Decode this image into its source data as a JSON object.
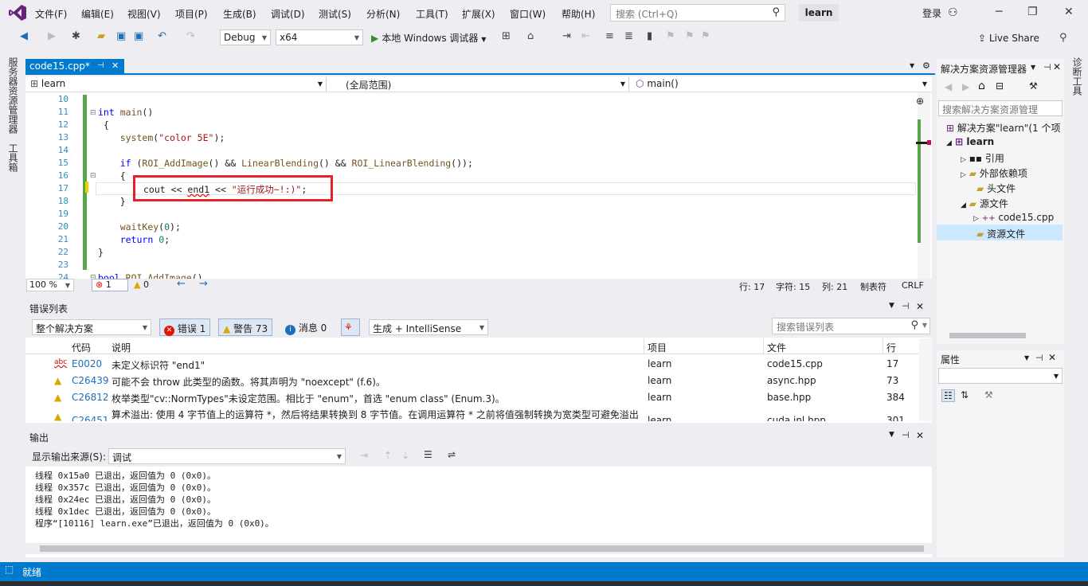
{
  "menu": {
    "items": [
      "文件(F)",
      "编辑(E)",
      "视图(V)",
      "项目(P)",
      "生成(B)",
      "调试(D)",
      "测试(S)",
      "分析(N)",
      "工具(T)",
      "扩展(X)",
      "窗口(W)",
      "帮助(H)"
    ],
    "search_placeholder": "搜索 (Ctrl+Q)",
    "project_name": "learn",
    "login": "登录"
  },
  "toolbar": {
    "config": "Debug",
    "platform": "x64",
    "run_label": "本地 Windows 调试器",
    "live_share": "Live Share"
  },
  "left_strip": {
    "server_explorer": "服务器资源管理器",
    "toolbox": "工具箱"
  },
  "right_strip": {
    "diagnostics": "诊断工具"
  },
  "editor": {
    "tab_label": "code15.cpp*",
    "nav_project": "learn",
    "nav_scope": "(全局范围)",
    "nav_function": "main()",
    "zoom": "100 %",
    "error_count": "1",
    "warning_count": "0",
    "line_info": "行: 17",
    "char_info": "字符: 15",
    "col_info": "列: 21",
    "tab_mode": "制表符",
    "line_ending": "CRLF",
    "line_numbers": [
      "10",
      "11",
      "12",
      "13",
      "14",
      "15",
      "16",
      "17",
      "18",
      "19",
      "20",
      "21",
      "22",
      "23",
      "24"
    ]
  },
  "error_list": {
    "title": "错误列表",
    "scope": "整个解决方案",
    "errors_btn": "错误 1",
    "warnings_btn": "警告 73",
    "messages_btn": "消息 0",
    "build_filter": "生成 + IntelliSense",
    "search_placeholder": "搜索错误列表",
    "columns": [
      "代码",
      "说明",
      "项目",
      "文件",
      "行"
    ],
    "rows": [
      {
        "code": "E0020",
        "desc": "未定义标识符 \"end1\"",
        "project": "learn",
        "file": "code15.cpp",
        "line": "17",
        "kind": "error"
      },
      {
        "code": "C26439",
        "desc": "可能不会 throw 此类型的函数。将其声明为 \"noexcept\" (f.6)。",
        "project": "learn",
        "file": "async.hpp",
        "line": "73",
        "kind": "warning"
      },
      {
        "code": "C26812",
        "desc": "枚举类型\"cv::NormTypes\"未设定范围。相比于 \"enum\"，首选 \"enum class\" (Enum.3)。",
        "project": "learn",
        "file": "base.hpp",
        "line": "384",
        "kind": "warning"
      },
      {
        "code": "C26451",
        "desc": "算术溢出: 使用 4 字节值上的运算符 *，然后将结果转换到 8 字节值。在调用运算符 * 之前将值强制转换为宽类型可避免溢出",
        "project": "learn",
        "file": "cuda.inl.hpp",
        "line": "301",
        "kind": "warning"
      }
    ]
  },
  "output": {
    "title": "输出",
    "source_label": "显示输出来源(S):",
    "source_value": "调试",
    "lines": [
      "线程 0x15a0 已退出，返回值为 0 (0x0)。",
      "线程 0x357c 已退出，返回值为 0 (0x0)。",
      "线程 0x24ec 已退出，返回值为 0 (0x0)。",
      "线程 0x1dec 已退出，返回值为 0 (0x0)。",
      "程序“[10116] learn.exe”已退出，返回值为 0 (0x0)。"
    ]
  },
  "solution_explorer": {
    "title": "解决方案资源管理器",
    "search_placeholder": "搜索解决方案资源管理",
    "items": [
      {
        "label": "解决方案\"learn\"(1 个项"
      },
      {
        "label": "learn"
      },
      {
        "label": "引用"
      },
      {
        "label": "外部依赖项"
      },
      {
        "label": "头文件"
      },
      {
        "label": "源文件"
      },
      {
        "label": "code15.cpp"
      },
      {
        "label": "资源文件"
      }
    ]
  },
  "properties": {
    "title": "属性"
  },
  "status": {
    "text": "就绪"
  },
  "colors": {
    "accent": "#007acc",
    "highlight": "#e8202a"
  }
}
